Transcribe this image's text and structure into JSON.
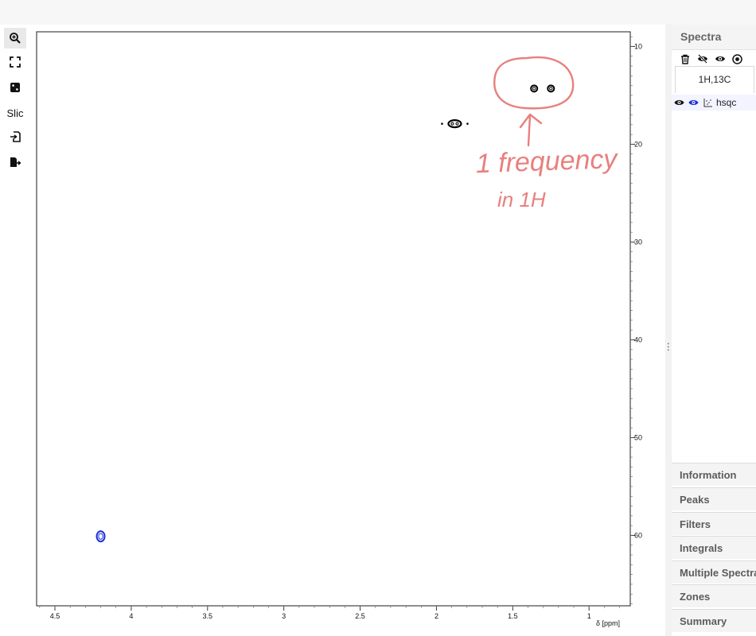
{
  "toolbar": {
    "tools": [
      {
        "icon": "zoom-in-icon",
        "active": true
      },
      {
        "icon": "fullscreen-icon",
        "active": false
      },
      {
        "icon": "peak-picking-icon",
        "active": false
      },
      {
        "label": "Slic",
        "active": false
      },
      {
        "icon": "import-icon",
        "active": false
      },
      {
        "icon": "export-icon",
        "active": false
      }
    ]
  },
  "spectrum_plot": {
    "x_axis": {
      "label": "δ [ppm]",
      "ticks": [
        "4.5",
        "4",
        "3.5",
        "3",
        "2.5",
        "2",
        "1.5",
        "1"
      ],
      "tick_values": [
        4.5,
        4.0,
        3.5,
        3.0,
        2.5,
        2.0,
        1.5,
        1.0
      ],
      "range_ppm": [
        4.62,
        0.73
      ]
    },
    "y_axis": {
      "ticks": [
        "10",
        "20",
        "30",
        "40",
        "50",
        "60"
      ],
      "tick_values": [
        10,
        20,
        30,
        40,
        50,
        60
      ],
      "range_ppm": [
        8.5,
        67.2
      ]
    },
    "peaks": [
      {
        "x_ppm": 1.88,
        "y_ppm": 17.9,
        "color": "#000000"
      },
      {
        "x_ppm": 1.36,
        "y_ppm": 14.3,
        "color": "#000000"
      },
      {
        "x_ppm": 1.25,
        "y_ppm": 14.3,
        "color": "#000000"
      },
      {
        "x_ppm": 4.2,
        "y_ppm": 60.1,
        "color": "#1a2fd6"
      }
    ],
    "annotation": {
      "lines": [
        "1 frequency",
        "in 1H"
      ],
      "color": "#e8807e"
    }
  },
  "panel": {
    "title": "Spectra",
    "icons": [
      "trash-icon",
      "hide-icon",
      "show-icon",
      "color-icon"
    ],
    "tab": "1H,13C",
    "spectra": [
      {
        "name": "hsqc",
        "color": "#1a2fd6"
      }
    ],
    "sections": [
      "Information",
      "Peaks",
      "Filters",
      "Integrals",
      "Multiple Spectra",
      "Zones",
      "Summary"
    ]
  }
}
